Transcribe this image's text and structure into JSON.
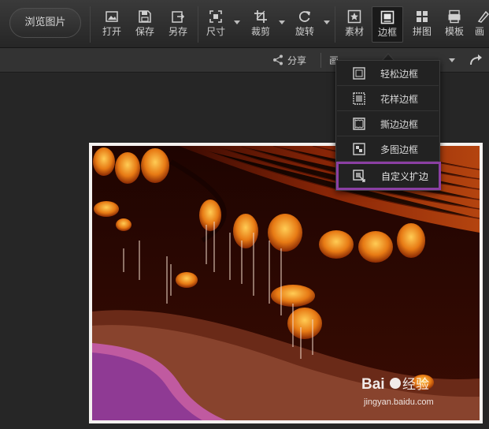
{
  "toolbar": {
    "browse_label": "浏览图片",
    "tools": [
      {
        "label": "打开",
        "icon": "open-image-icon"
      },
      {
        "label": "保存",
        "icon": "save-icon"
      },
      {
        "label": "另存",
        "icon": "save-as-icon"
      },
      {
        "label": "尺寸",
        "icon": "resize-icon"
      },
      {
        "label": "裁剪",
        "icon": "crop-icon"
      },
      {
        "label": "旋转",
        "icon": "rotate-icon"
      },
      {
        "label": "素材",
        "icon": "material-star-icon"
      },
      {
        "label": "边框",
        "icon": "border-icon",
        "active": true
      },
      {
        "label": "拼图",
        "icon": "collage-grid-icon"
      },
      {
        "label": "模板",
        "icon": "template-icon"
      },
      {
        "label": "画",
        "icon": "paint-icon"
      }
    ]
  },
  "subbar": {
    "share_label": "分享",
    "partial_text": "画"
  },
  "border_menu": {
    "items": [
      {
        "label": "轻松边框",
        "icon": "simple-border-icon"
      },
      {
        "label": "花样边框",
        "icon": "pattern-border-icon"
      },
      {
        "label": "撕边边框",
        "icon": "torn-border-icon"
      },
      {
        "label": "多图边框",
        "icon": "multi-image-border-icon"
      },
      {
        "label": "自定义扩边",
        "icon": "custom-expand-border-icon",
        "highlighted": true
      }
    ],
    "highlight_color": "#8b3fa3"
  },
  "watermark": {
    "brand": "Baidu",
    "brand_cn": "经验",
    "url": "jingyan.baidu.com"
  },
  "colors": {
    "toolbar_bg": "#2e2e2e",
    "canvas_bg": "#262626",
    "frame": "#f4f1ef"
  }
}
